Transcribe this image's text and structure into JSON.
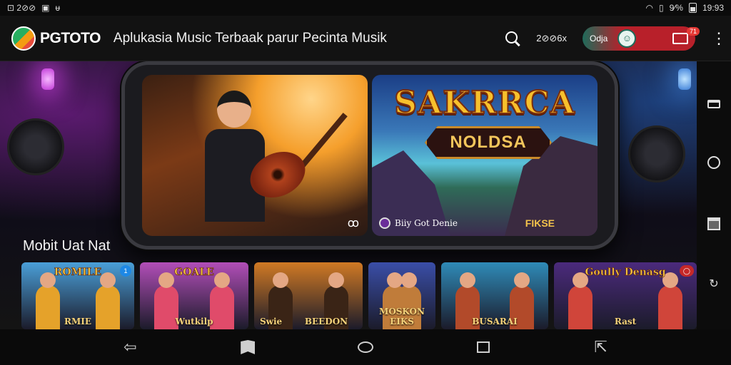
{
  "status_bar": {
    "left_text": "⊡ 2⊘⊘",
    "battery_text": "9⁄%",
    "time": "19:93"
  },
  "header": {
    "logo_text": "PGTOTO",
    "title": "Aplukasia Music Terbaak parur Pecinta Musik",
    "count_text": "2⊘⊘6x",
    "user_name": "Odja",
    "mail_badge": "71"
  },
  "hero": {
    "banner_1": {
      "corner_glyph": "ꝏ"
    },
    "banner_2": {
      "title": "SAKRRCA",
      "subtitle": "NOLDSA",
      "footer_left": "Biiy Got Denie",
      "footer_right": "FIKSE"
    }
  },
  "section": {
    "title": "Mobit Uat Nat"
  },
  "tiles": [
    {
      "title": "ROMILE",
      "label": "RMIE",
      "bg": "#4a9fd8",
      "accent": "#e5a22a",
      "badge": "1"
    },
    {
      "title": "GOALE",
      "label": "Wutkilp",
      "bg": "#b24eb8",
      "accent": "#e04b6a",
      "badge": ""
    },
    {
      "title": "",
      "label": "BEEDON",
      "bg": "#d17a24",
      "accent": "#3a2416",
      "badge": "",
      "left_label": "Swie"
    },
    {
      "title": "",
      "label": "MOSKON EIKS",
      "bg": "#3a4ea8",
      "accent": "#c07c3a",
      "badge": ""
    },
    {
      "title": "",
      "label": "BUSARAI",
      "bg": "#2f8bb8",
      "accent": "#b24a2a",
      "badge": ""
    },
    {
      "title": "Goully Denasg",
      "label": "Rast",
      "bg": "#4b2a7c",
      "accent": "#d0453a",
      "badge": "◯"
    }
  ],
  "colors": {
    "header_bg": "#121212",
    "pill_red": "#b8202a",
    "pill_green": "#1f6b5a",
    "badge_red": "#e53935"
  },
  "icons": {
    "header": [
      "search-icon",
      "avatar",
      "mail-icon",
      "kebab-menu-icon"
    ],
    "side_nav": [
      "tray-icon",
      "circle-icon",
      "square-icon",
      "rotate-icon"
    ],
    "nav_bar": [
      "back-icon",
      "shield-icon",
      "home-icon",
      "recents-icon",
      "screenshot-icon"
    ]
  }
}
